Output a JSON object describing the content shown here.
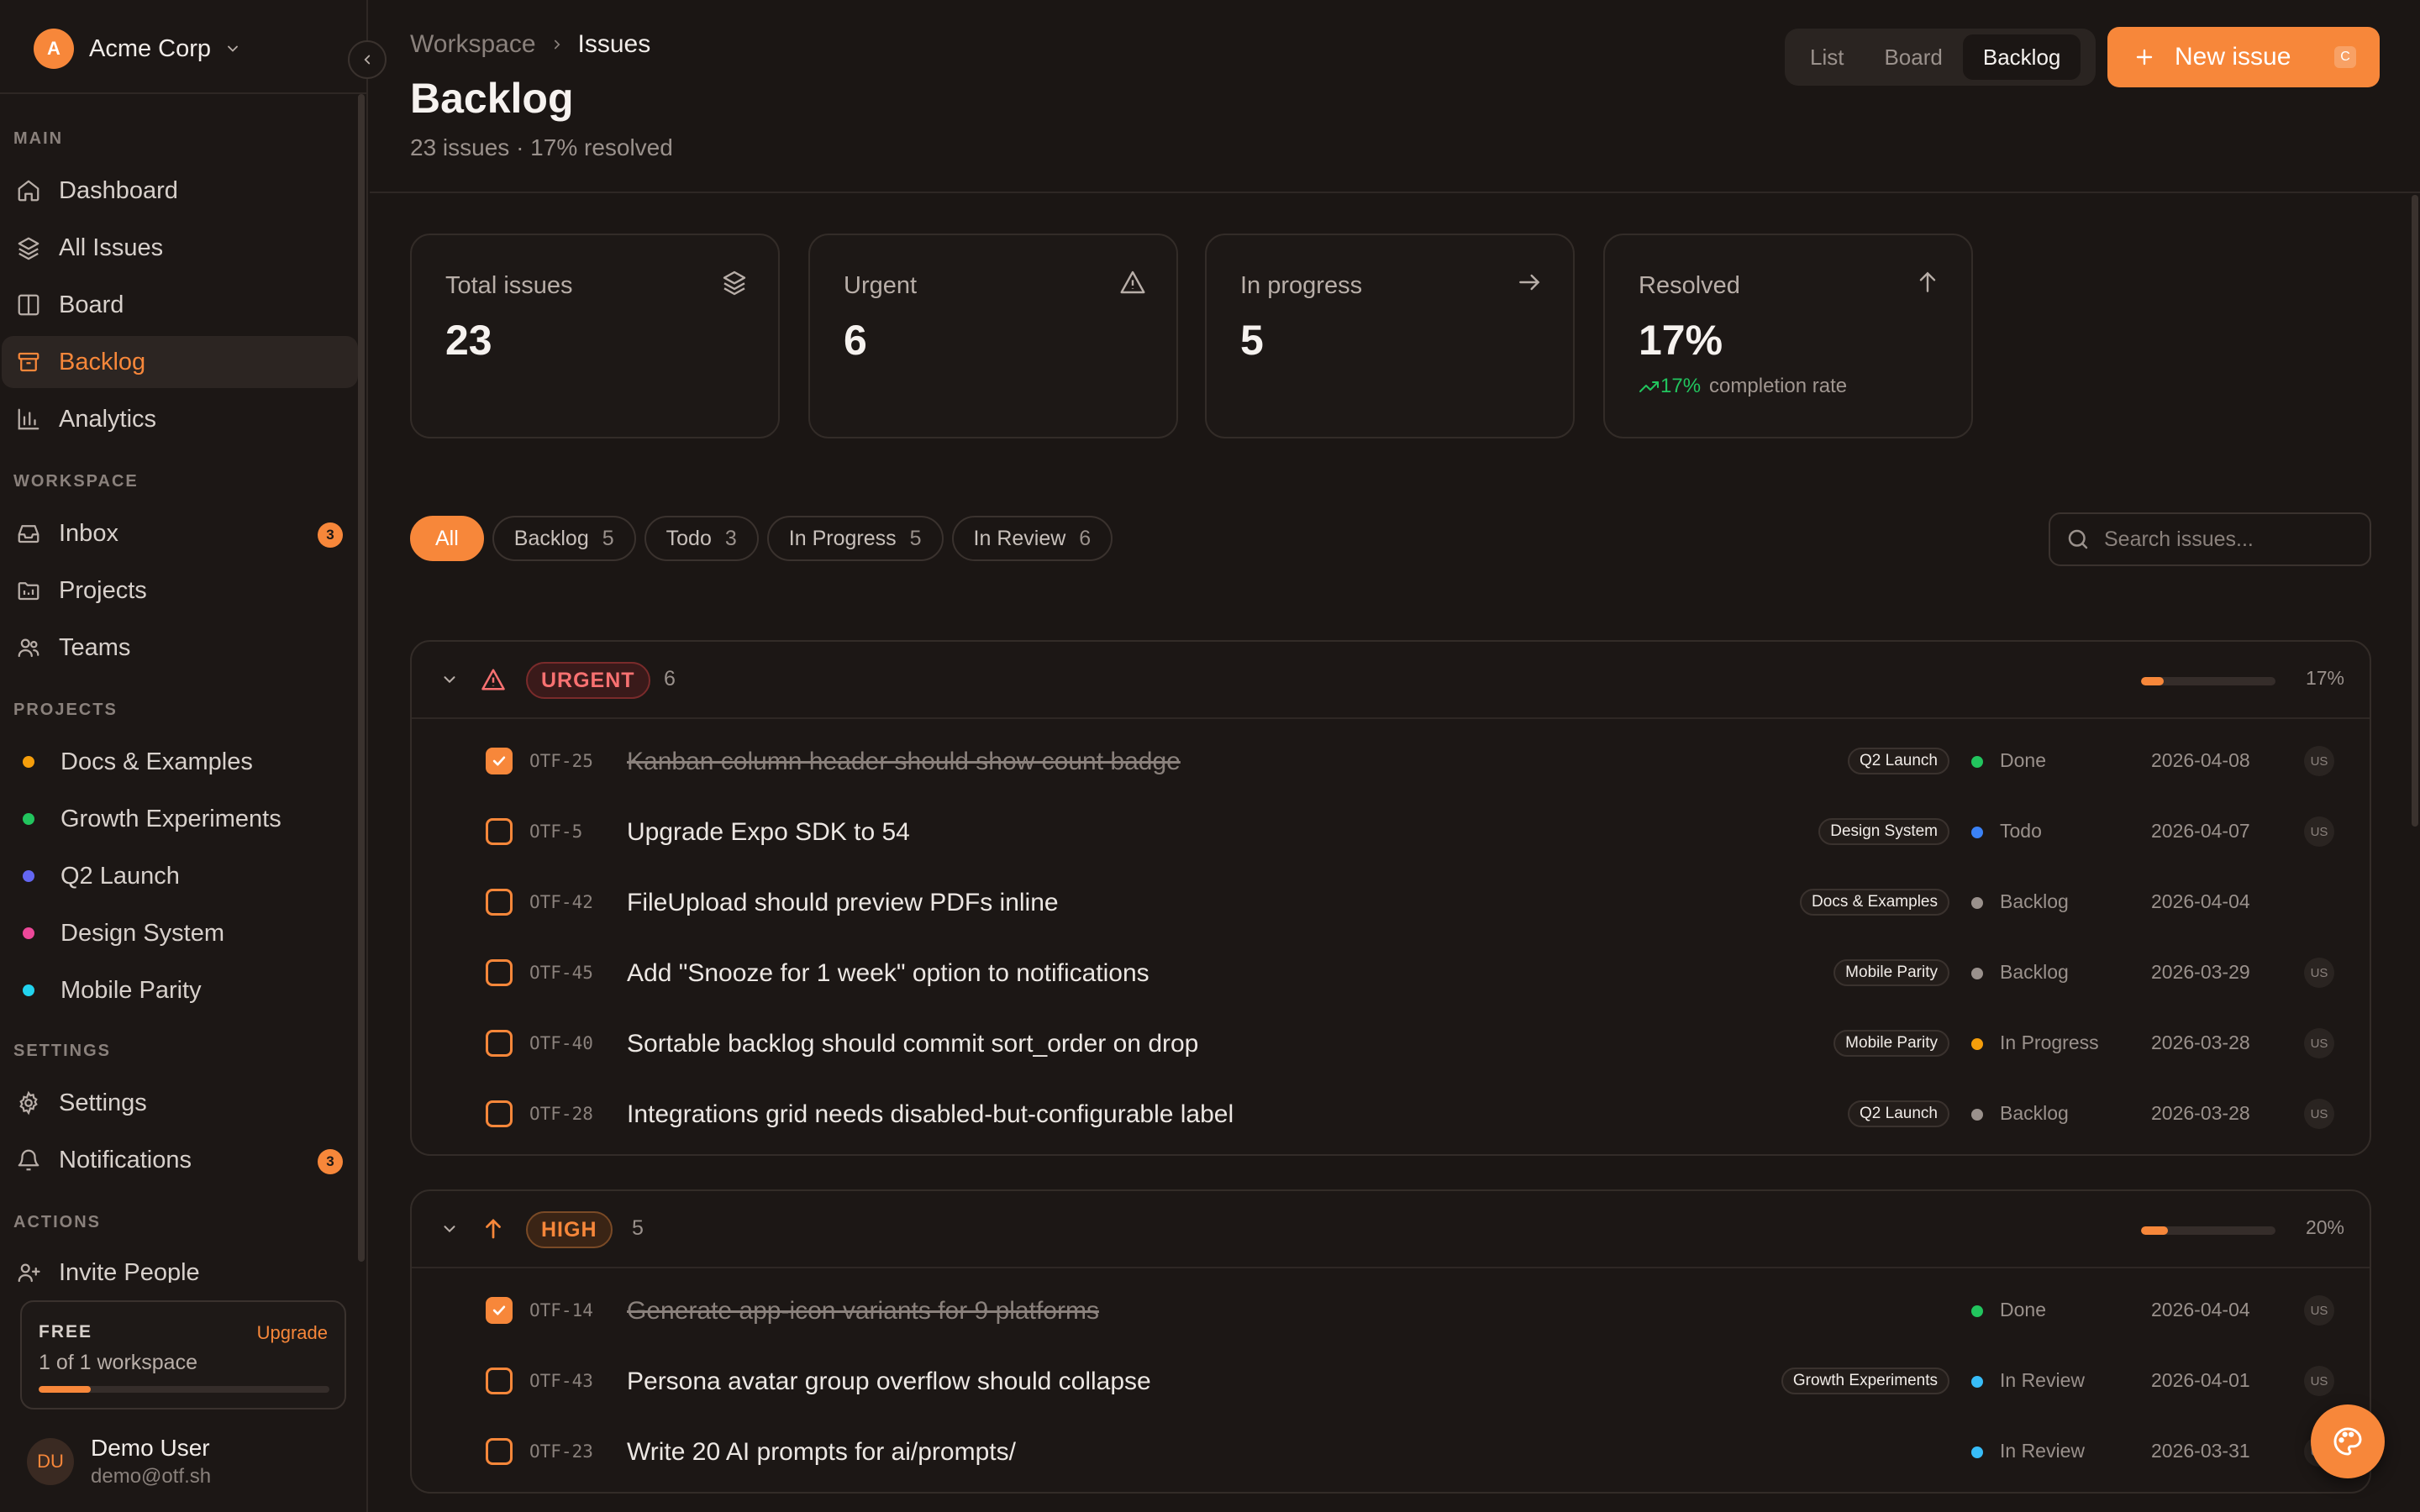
{
  "org": {
    "initial": "A",
    "name": "Acme Corp"
  },
  "sidebar": {
    "sections": {
      "main": "MAIN",
      "workspace": "WORKSPACE",
      "projects": "PROJECTS",
      "settings": "SETTINGS",
      "actions": "ACTIONS"
    },
    "main_items": [
      {
        "label": "Dashboard",
        "icon": "home-icon"
      },
      {
        "label": "All Issues",
        "icon": "layers-icon"
      },
      {
        "label": "Board",
        "icon": "columns-icon"
      },
      {
        "label": "Backlog",
        "icon": "archive-icon",
        "active": true
      },
      {
        "label": "Analytics",
        "icon": "bar-chart-icon"
      }
    ],
    "workspace_items": [
      {
        "label": "Inbox",
        "icon": "inbox-icon",
        "badge": "3"
      },
      {
        "label": "Projects",
        "icon": "folder-icon"
      },
      {
        "label": "Teams",
        "icon": "users-icon"
      }
    ],
    "projects": [
      {
        "label": "Docs & Examples",
        "color": "#f59e0b"
      },
      {
        "label": "Growth Experiments",
        "color": "#22c55e"
      },
      {
        "label": "Q2 Launch",
        "color": "#6366f1"
      },
      {
        "label": "Design System",
        "color": "#ec4899"
      },
      {
        "label": "Mobile Parity",
        "color": "#22d3ee"
      }
    ],
    "settings_items": [
      {
        "label": "Settings",
        "icon": "gear-icon"
      },
      {
        "label": "Notifications",
        "icon": "bell-icon",
        "badge": "3"
      }
    ],
    "action_items": [
      {
        "label": "Invite People",
        "icon": "user-plus-icon"
      }
    ],
    "plan": {
      "name": "FREE",
      "upgrade": "Upgrade",
      "usage": "1 of 1 workspace",
      "usage_fraction": 0.18
    },
    "user": {
      "initials": "DU",
      "name": "Demo User",
      "email": "demo@otf.sh"
    }
  },
  "header": {
    "breadcrumb": [
      "Workspace",
      "Issues"
    ],
    "title": "Backlog",
    "subtitle": "23 issues · 17% resolved",
    "views": [
      "List",
      "Board",
      "Backlog"
    ],
    "active_view": "Backlog",
    "new_issue": "New issue",
    "new_issue_shortcut": "C"
  },
  "stats": [
    {
      "label": "Total issues",
      "value": "23",
      "icon": "layers-icon"
    },
    {
      "label": "Urgent",
      "value": "6",
      "icon": "alert-triangle-icon"
    },
    {
      "label": "In progress",
      "value": "5",
      "icon": "arrow-right-icon"
    },
    {
      "label": "Resolved",
      "value": "17%",
      "icon": "arrow-up-icon",
      "trend": "17%",
      "trend_label": "completion rate"
    }
  ],
  "filters": [
    {
      "label": "All",
      "count": "",
      "active": true
    },
    {
      "label": "Backlog",
      "count": "5"
    },
    {
      "label": "Todo",
      "count": "3"
    },
    {
      "label": "In Progress",
      "count": "5"
    },
    {
      "label": "In Review",
      "count": "6"
    }
  ],
  "search": {
    "placeholder": "Search issues..."
  },
  "colors": {
    "accent": "#f7873a",
    "done": "#22c55e",
    "todo": "#3b82f6",
    "backlog": "#9a918c",
    "in_progress": "#f59e0b",
    "in_review": "#38bdf8",
    "urgent": "#f87171"
  },
  "groups": [
    {
      "id": "urgent",
      "label": "URGENT",
      "count": "6",
      "percent": "17%",
      "progress": 0.17,
      "issues": [
        {
          "id": "OTF-25",
          "title": "Kanban column header should show count badge",
          "done": true,
          "project": "Q2 Launch",
          "status": "Done",
          "status_color": "#22c55e",
          "date": "2026-04-08",
          "assignee": "US"
        },
        {
          "id": "OTF-5",
          "title": "Upgrade Expo SDK to 54",
          "done": false,
          "project": "Design System",
          "status": "Todo",
          "status_color": "#3b82f6",
          "date": "2026-04-07",
          "assignee": "US"
        },
        {
          "id": "OTF-42",
          "title": "FileUpload should preview PDFs inline",
          "done": false,
          "project": "Docs & Examples",
          "status": "Backlog",
          "status_color": "#9a918c",
          "date": "2026-04-04",
          "assignee": ""
        },
        {
          "id": "OTF-45",
          "title": "Add \"Snooze for 1 week\" option to notifications",
          "done": false,
          "project": "Mobile Parity",
          "status": "Backlog",
          "status_color": "#9a918c",
          "date": "2026-03-29",
          "assignee": "US"
        },
        {
          "id": "OTF-40",
          "title": "Sortable backlog should commit sort_order on drop",
          "done": false,
          "project": "Mobile Parity",
          "status": "In Progress",
          "status_color": "#f59e0b",
          "date": "2026-03-28",
          "assignee": "US"
        },
        {
          "id": "OTF-28",
          "title": "Integrations grid needs disabled-but-configurable label",
          "done": false,
          "project": "Q2 Launch",
          "status": "Backlog",
          "status_color": "#9a918c",
          "date": "2026-03-28",
          "assignee": "US"
        }
      ]
    },
    {
      "id": "high",
      "label": "HIGH",
      "count": "5",
      "percent": "20%",
      "progress": 0.2,
      "issues": [
        {
          "id": "OTF-14",
          "title": "Generate app-icon variants for 9 platforms",
          "done": true,
          "project": "",
          "status": "Done",
          "status_color": "#22c55e",
          "date": "2026-04-04",
          "assignee": "US"
        },
        {
          "id": "OTF-43",
          "title": "Persona avatar group overflow should collapse",
          "done": false,
          "project": "Growth Experiments",
          "status": "In Review",
          "status_color": "#38bdf8",
          "date": "2026-04-01",
          "assignee": "US"
        },
        {
          "id": "OTF-23",
          "title": "Write 20 AI prompts for ai/prompts/",
          "done": false,
          "project": "",
          "status": "In Review",
          "status_color": "#38bdf8",
          "date": "2026-03-31",
          "assignee": "US"
        }
      ]
    }
  ]
}
